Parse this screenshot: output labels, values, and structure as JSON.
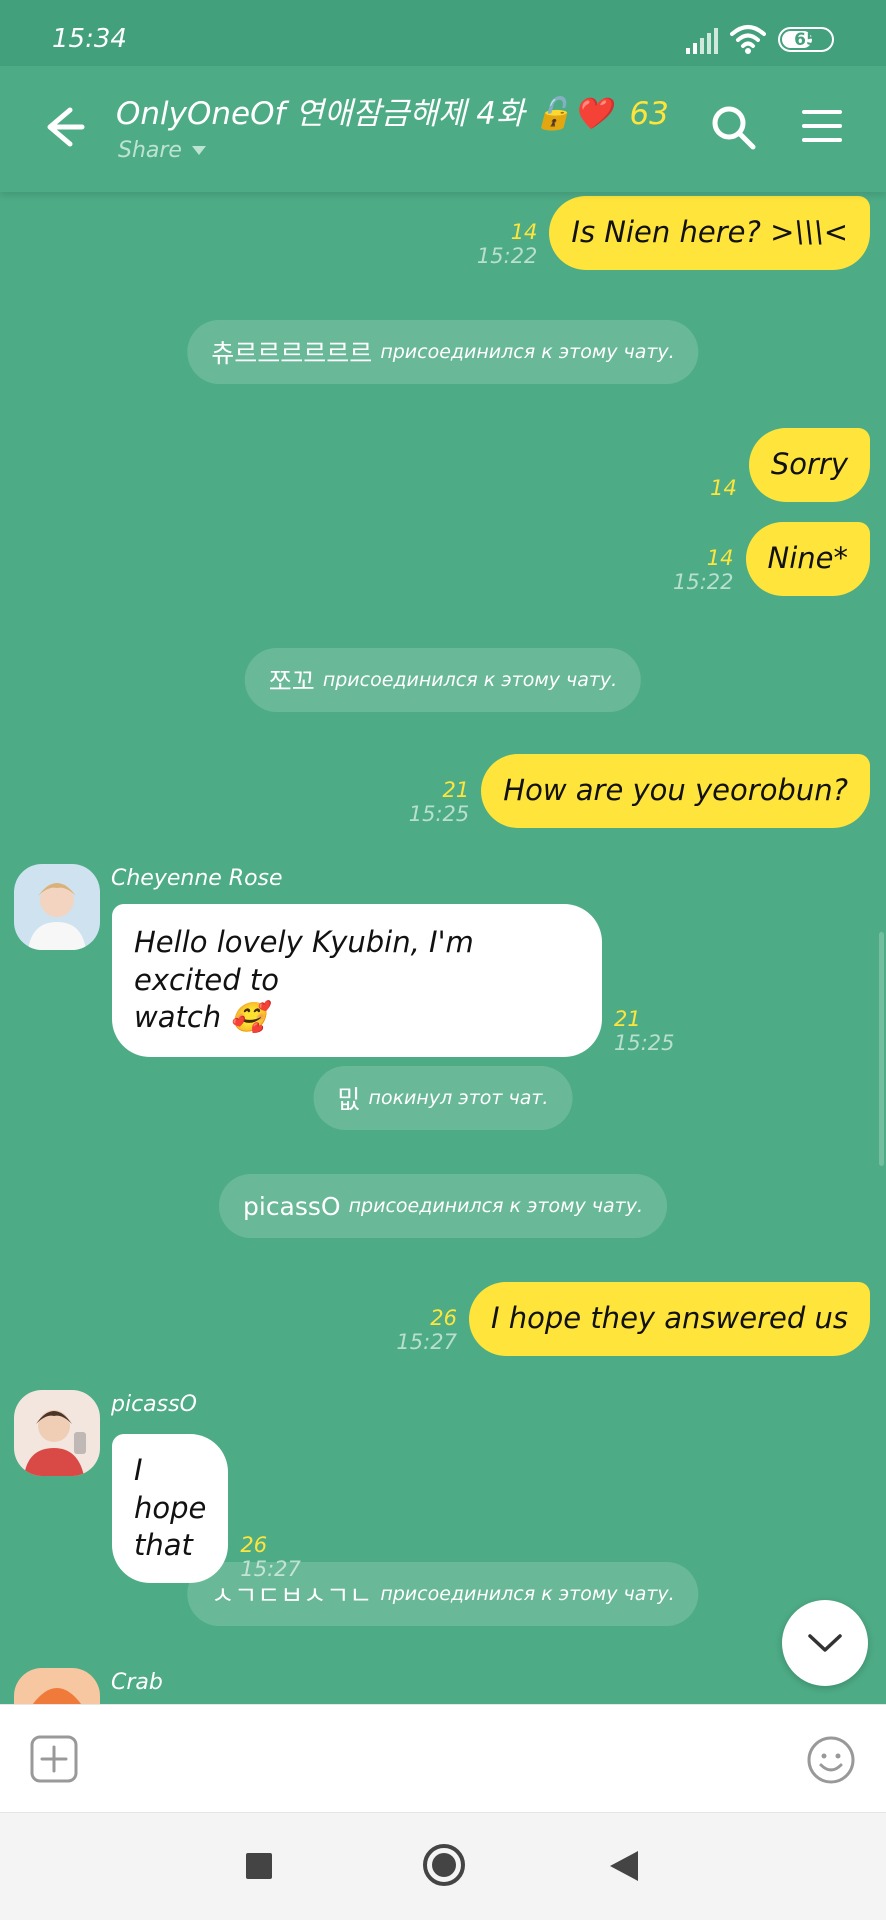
{
  "status_bar": {
    "time": "15:34",
    "battery": "65",
    "battery_level": 0.65
  },
  "header": {
    "title": "OnlyOneOf 연애잠금해제 4화",
    "title_emojis": "🔓❤️",
    "member_count": "63",
    "share_label": "Share"
  },
  "messages": {
    "m1": {
      "text": "Is Nien here? >\\\\\\<",
      "count": "14",
      "time": "15:22"
    },
    "sys1": {
      "name": "츄르르르르르르",
      "action": "присоединился к этому чату."
    },
    "m2": {
      "text": "Sorry",
      "count": "14"
    },
    "m3": {
      "text": "Nine*",
      "count": "14",
      "time": "15:22"
    },
    "sys2": {
      "name": "쪼꼬",
      "action": "присоединился к этому чату."
    },
    "m4": {
      "text": "How are you yeorobun?",
      "count": "21",
      "time": "15:25"
    },
    "in1": {
      "sender": "Cheyenne Rose",
      "text_line1": "Hello lovely Kyubin, I'm excited to",
      "text_line2": "watch 🥰",
      "count": "21",
      "time": "15:25"
    },
    "sys3": {
      "name": "밊",
      "action": "покинул этот чат."
    },
    "sys4": {
      "name": "picassO",
      "action": "присоединился к этому чату."
    },
    "m5": {
      "text": "I hope they answered us",
      "count": "26",
      "time": "15:27"
    },
    "in2": {
      "sender": "picassO",
      "text": "I hope that",
      "count": "26",
      "time": "15:27"
    },
    "sys5": {
      "name": "ㅅㄱㄷㅂㅅㄱㄴ",
      "action": "присоединился к этому чату."
    },
    "in3": {
      "sender": "Crab"
    }
  },
  "icons": {
    "back": "arrow-left-icon",
    "search": "search-icon",
    "menu": "hamburger-menu-icon",
    "scroll_down": "chevron-down-icon",
    "add": "plus-square-icon",
    "emoji": "smiley-icon"
  },
  "colors": {
    "background": "#4dac86",
    "header": "#4dac86",
    "status_bar": "#43a07c",
    "outgoing_bubble": "#ffe53b",
    "incoming_bubble": "#ffffff",
    "unread_count": "#ffe53b"
  }
}
